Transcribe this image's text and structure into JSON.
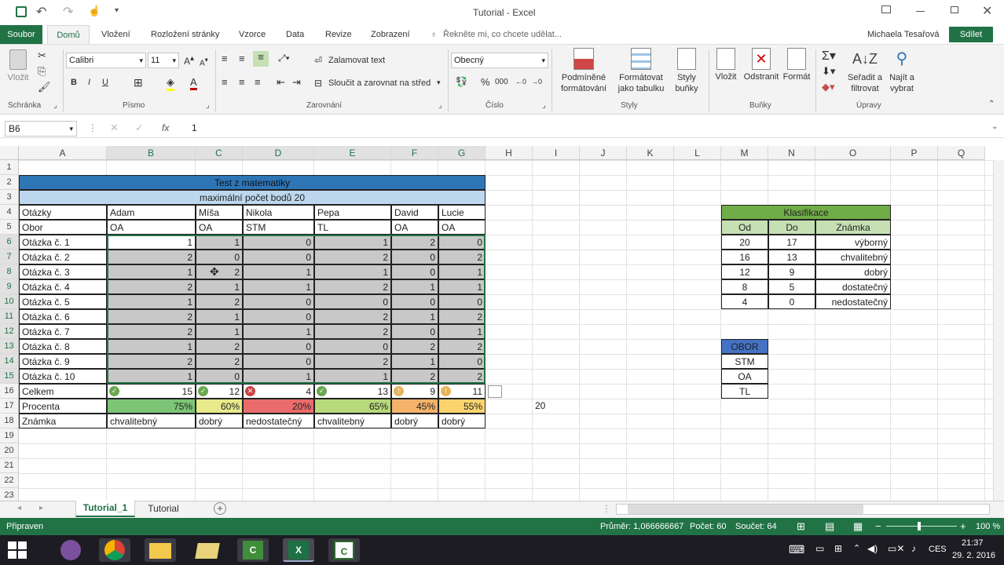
{
  "window": {
    "title": "Tutorial - Excel",
    "user": "Michaela Tesařová",
    "share": "Sdílet"
  },
  "tabs": [
    "Soubor",
    "Domů",
    "Vložení",
    "Rozložení stránky",
    "Vzorce",
    "Data",
    "Revize",
    "Zobrazení"
  ],
  "tell_me": "Řekněte mi, co chcete udělat...",
  "ribbon": {
    "paste": "Vložit",
    "font_name": "Calibri",
    "font_size": "11",
    "bold": "B",
    "italic": "I",
    "underline": "U",
    "wrap": "Zalamovat text",
    "merge": "Sloučit a zarovnat na střed",
    "number_format": "Obecný",
    "cond_format": "Podmíněné formátování",
    "format_table": "Formátovat jako tabulku",
    "cell_styles": "Styly buňky",
    "insert": "Vložit",
    "delete": "Odstranit",
    "format": "Formát",
    "sort": "Seřadit a filtrovat",
    "find": "Najít a vybrat",
    "groups": {
      "clipboard": "Schránka",
      "font": "Písmo",
      "align": "Zarovnání",
      "number": "Číslo",
      "styles": "Styly",
      "cells": "Buňky",
      "editing": "Úpravy"
    }
  },
  "formula_bar": {
    "name_box": "B6",
    "fx": "fx",
    "value": "1"
  },
  "columns": [
    "A",
    "B",
    "C",
    "D",
    "E",
    "F",
    "G",
    "H",
    "I",
    "J",
    "K",
    "L",
    "M",
    "N",
    "O",
    "P",
    "Q"
  ],
  "rows": [
    "1",
    "2",
    "3",
    "4",
    "5",
    "6",
    "7",
    "8",
    "9",
    "10",
    "11",
    "12",
    "13",
    "14",
    "15",
    "16",
    "17",
    "18",
    "19",
    "20",
    "21",
    "22",
    "23"
  ],
  "sheet": {
    "title": "Test z matematiky",
    "subtitle": "maximální počet bodů 20",
    "header_label": "Otázky",
    "obor_label": "Obor",
    "students": [
      "Adam",
      "Míša",
      "Nikola",
      "Pepa",
      "David",
      "Lucie"
    ],
    "obory": [
      "OA",
      "OA",
      "STM",
      "TL",
      "OA",
      "OA"
    ],
    "questions": [
      "Otázka č. 1",
      "Otázka č. 2",
      "Otázka č. 3",
      "Otázka č. 4",
      "Otázka č. 5",
      "Otázka č. 6",
      "Otázka č. 7",
      "Otázka č. 8",
      "Otázka č. 9",
      "Otázka č. 10"
    ],
    "scores": [
      [
        "1",
        "1",
        "0",
        "1",
        "2",
        "0"
      ],
      [
        "2",
        "0",
        "0",
        "2",
        "0",
        "2"
      ],
      [
        "1",
        "2",
        "1",
        "1",
        "0",
        "1"
      ],
      [
        "2",
        "1",
        "1",
        "2",
        "1",
        "1"
      ],
      [
        "1",
        "2",
        "0",
        "0",
        "0",
        "0"
      ],
      [
        "2",
        "1",
        "0",
        "2",
        "1",
        "2"
      ],
      [
        "2",
        "1",
        "1",
        "2",
        "0",
        "1"
      ],
      [
        "1",
        "2",
        "0",
        "0",
        "2",
        "2"
      ],
      [
        "2",
        "2",
        "0",
        "2",
        "1",
        "0"
      ],
      [
        "1",
        "0",
        "1",
        "1",
        "2",
        "2"
      ]
    ],
    "total_label": "Celkem",
    "totals": [
      "15",
      "12",
      "4",
      "13",
      "9",
      "11"
    ],
    "percent_label": "Procenta",
    "percents": [
      "75%",
      "60%",
      "20%",
      "65%",
      "45%",
      "55%"
    ],
    "grade_label": "Známka",
    "grades": [
      "chvalitebný",
      "dobrý",
      "nedostatečný",
      "chvalitebný",
      "dobrý",
      "dobrý"
    ],
    "i17": "20"
  },
  "klasifikace": {
    "title": "Klasifikace",
    "headers": [
      "Od",
      "Do",
      "Známka"
    ],
    "rows": [
      [
        "20",
        "17",
        "výborný"
      ],
      [
        "16",
        "13",
        "chvalitebný"
      ],
      [
        "12",
        "9",
        "dobrý"
      ],
      [
        "8",
        "5",
        "dostatečný"
      ],
      [
        "4",
        "0",
        "nedostatečný"
      ]
    ]
  },
  "obor_list": {
    "title": "OBOR",
    "items": [
      "STM",
      "OA",
      "TL"
    ]
  },
  "sheet_tabs": [
    "Tutorial_1",
    "Tutorial"
  ],
  "status": {
    "ready": "Připraven",
    "avg": "Průměr: 1,066666667",
    "count": "Počet: 60",
    "sum": "Součet: 64",
    "zoom": "100 %"
  },
  "taskbar": {
    "lang": "CES",
    "time": "21:37",
    "date": "29. 2. 2016"
  },
  "colors": {
    "excel_green": "#217346",
    "title_blue": "#2e75b6",
    "subtitle_blue": "#bdd7ee",
    "klas_green": "#70ad47",
    "klas_light": "#c6e0b4",
    "obor_blue": "#4472c4"
  }
}
